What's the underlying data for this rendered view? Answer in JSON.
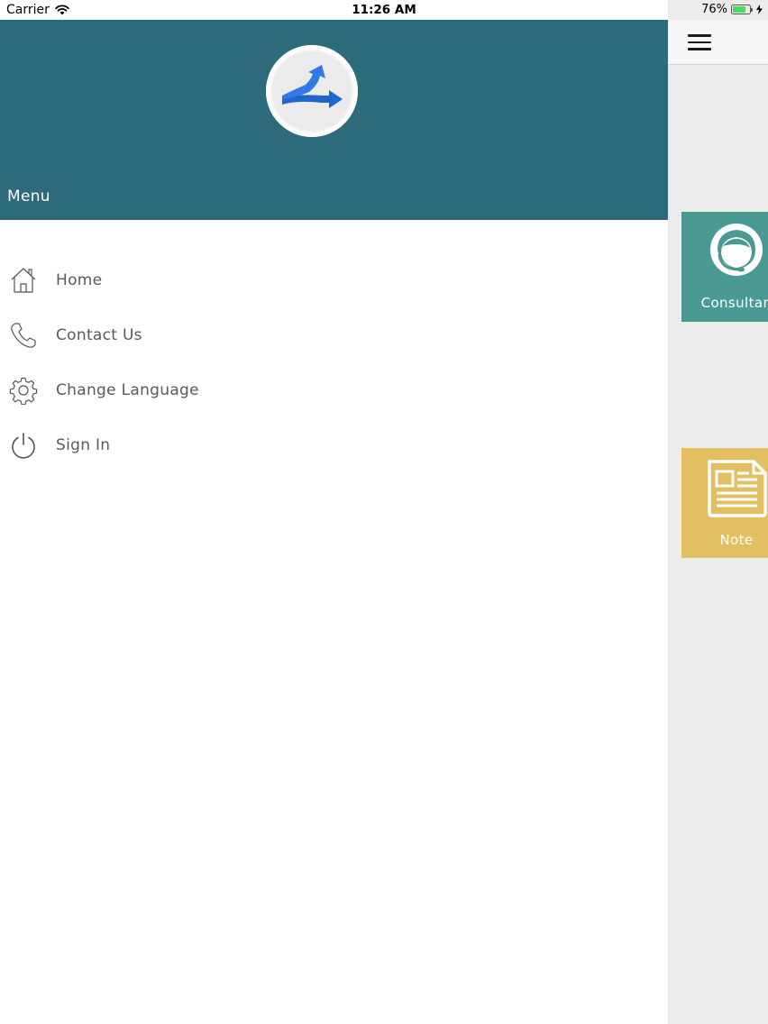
{
  "status_bar": {
    "carrier": "Carrier",
    "time": "11:26 AM",
    "battery_percent": "76%",
    "battery_level": 0.76,
    "battery_color": "#4cd964"
  },
  "drawer": {
    "header_color": "#2d6a7b",
    "logo": {
      "arrow_color": "#2a6fd6",
      "icon": "split-arrow-logo"
    },
    "menu_title": "Menu",
    "items": [
      {
        "label": "Home",
        "icon": "home-icon"
      },
      {
        "label": "Contact Us",
        "icon": "phone-icon"
      },
      {
        "label": "Change Language",
        "icon": "gear-icon"
      },
      {
        "label": "Sign In",
        "icon": "power-icon"
      }
    ]
  },
  "main": {
    "menu_icon": "hamburger-icon",
    "tiles": [
      {
        "label": "Consultan",
        "color": "#4a9a93",
        "icon": "headset-user-icon"
      },
      {
        "label": "Note",
        "color": "#e2c062",
        "icon": "newspaper-icon"
      }
    ]
  }
}
